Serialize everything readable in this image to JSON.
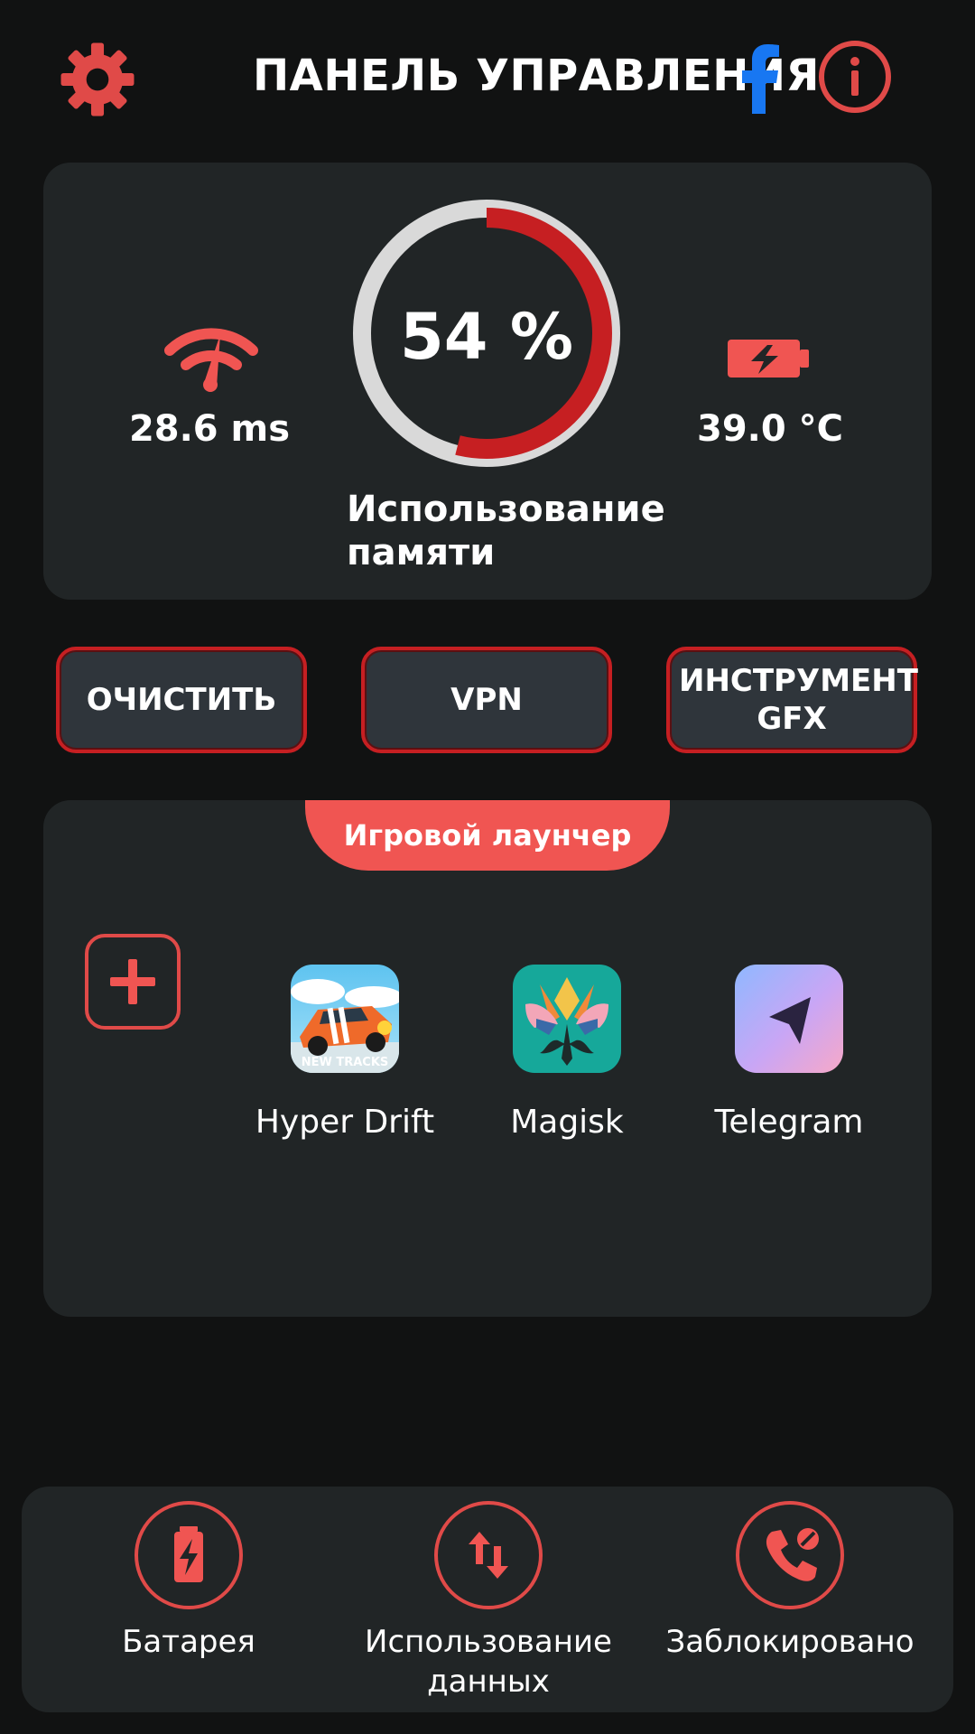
{
  "header": {
    "title": "ПАНЕЛЬ УПРАВЛЕНИЯ",
    "settings_icon": "gear-icon",
    "facebook_icon": "facebook-icon",
    "info_icon": "info-icon"
  },
  "stats": {
    "ping": {
      "icon": "signal-speed-icon",
      "value": "28.6 ms"
    },
    "memory": {
      "value_text": "54 %",
      "percent": 54,
      "label": "Использование памяти"
    },
    "temperature": {
      "icon": "battery-charging-icon",
      "value": "39.0 °C"
    }
  },
  "actions": {
    "clean_label": "ОЧИСТИТЬ",
    "vpn_label": "VPN",
    "gfx_label": "ИНСТРУМЕНТ GFX"
  },
  "launcher": {
    "title": "Игровой лаунчер",
    "add_icon": "plus-icon",
    "apps": [
      {
        "name": "Hyper Drift",
        "icon": "hyper-drift-app-icon",
        "badge": "NEW TRACKS"
      },
      {
        "name": "Magisk",
        "icon": "magisk-app-icon"
      },
      {
        "name": "Telegram",
        "icon": "telegram-app-icon"
      }
    ]
  },
  "bottom_nav": [
    {
      "label": "Батарея",
      "icon": "battery-icon"
    },
    {
      "label": "Использование данных",
      "icon": "data-transfer-icon"
    },
    {
      "label": "Заблокировано",
      "icon": "blocked-call-icon"
    }
  ],
  "colors": {
    "accent": "#f05552",
    "accent_dark": "#c61f22",
    "card": "#212526",
    "background": "#111212",
    "facebook": "#1877f2"
  }
}
